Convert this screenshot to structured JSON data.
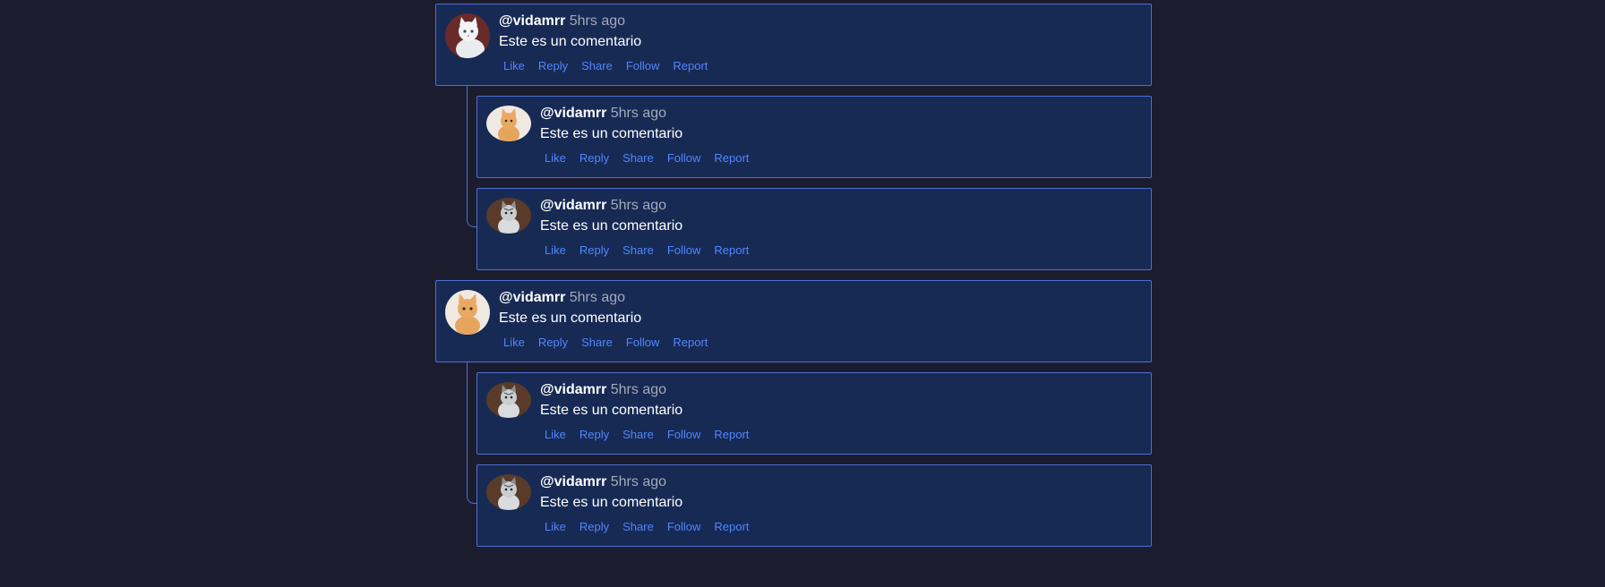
{
  "thread": {
    "comments": [
      {
        "username": "@vidamrr",
        "time": "5hrs ago",
        "text": "Este es un comentario",
        "avatar": "white-kitten-avatar",
        "actions": [
          "Like",
          "Reply",
          "Share",
          "Follow",
          "Report"
        ],
        "replies": [
          {
            "username": "@vidamrr",
            "time": "5hrs ago",
            "text": "Este es un comentario",
            "avatar": "orange-kitten-avatar",
            "actions": [
              "Like",
              "Reply",
              "Share",
              "Follow",
              "Report"
            ]
          },
          {
            "username": "@vidamrr",
            "time": "5hrs ago",
            "text": "Este es un comentario",
            "avatar": "tabby-kitten-avatar",
            "actions": [
              "Like",
              "Reply",
              "Share",
              "Follow",
              "Report"
            ]
          }
        ]
      },
      {
        "username": "@vidamrr",
        "time": "5hrs ago",
        "text": "Este es un comentario",
        "avatar": "orange-kitten-avatar",
        "actions": [
          "Like",
          "Reply",
          "Share",
          "Follow",
          "Report"
        ],
        "replies": [
          {
            "username": "@vidamrr",
            "time": "5hrs ago",
            "text": "Este es un comentario",
            "avatar": "tabby-kitten-avatar",
            "actions": [
              "Like",
              "Reply",
              "Share",
              "Follow",
              "Report"
            ]
          },
          {
            "username": "@vidamrr",
            "time": "5hrs ago",
            "text": "Este es un comentario",
            "avatar": "tabby-kitten-avatar",
            "actions": [
              "Like",
              "Reply",
              "Share",
              "Follow",
              "Report"
            ]
          }
        ]
      }
    ]
  },
  "colors": {
    "background": "#1c1c2f",
    "card": "#172a54",
    "border": "#4d6fd6",
    "link": "#4f86ff",
    "muted": "#a3a9b8"
  }
}
